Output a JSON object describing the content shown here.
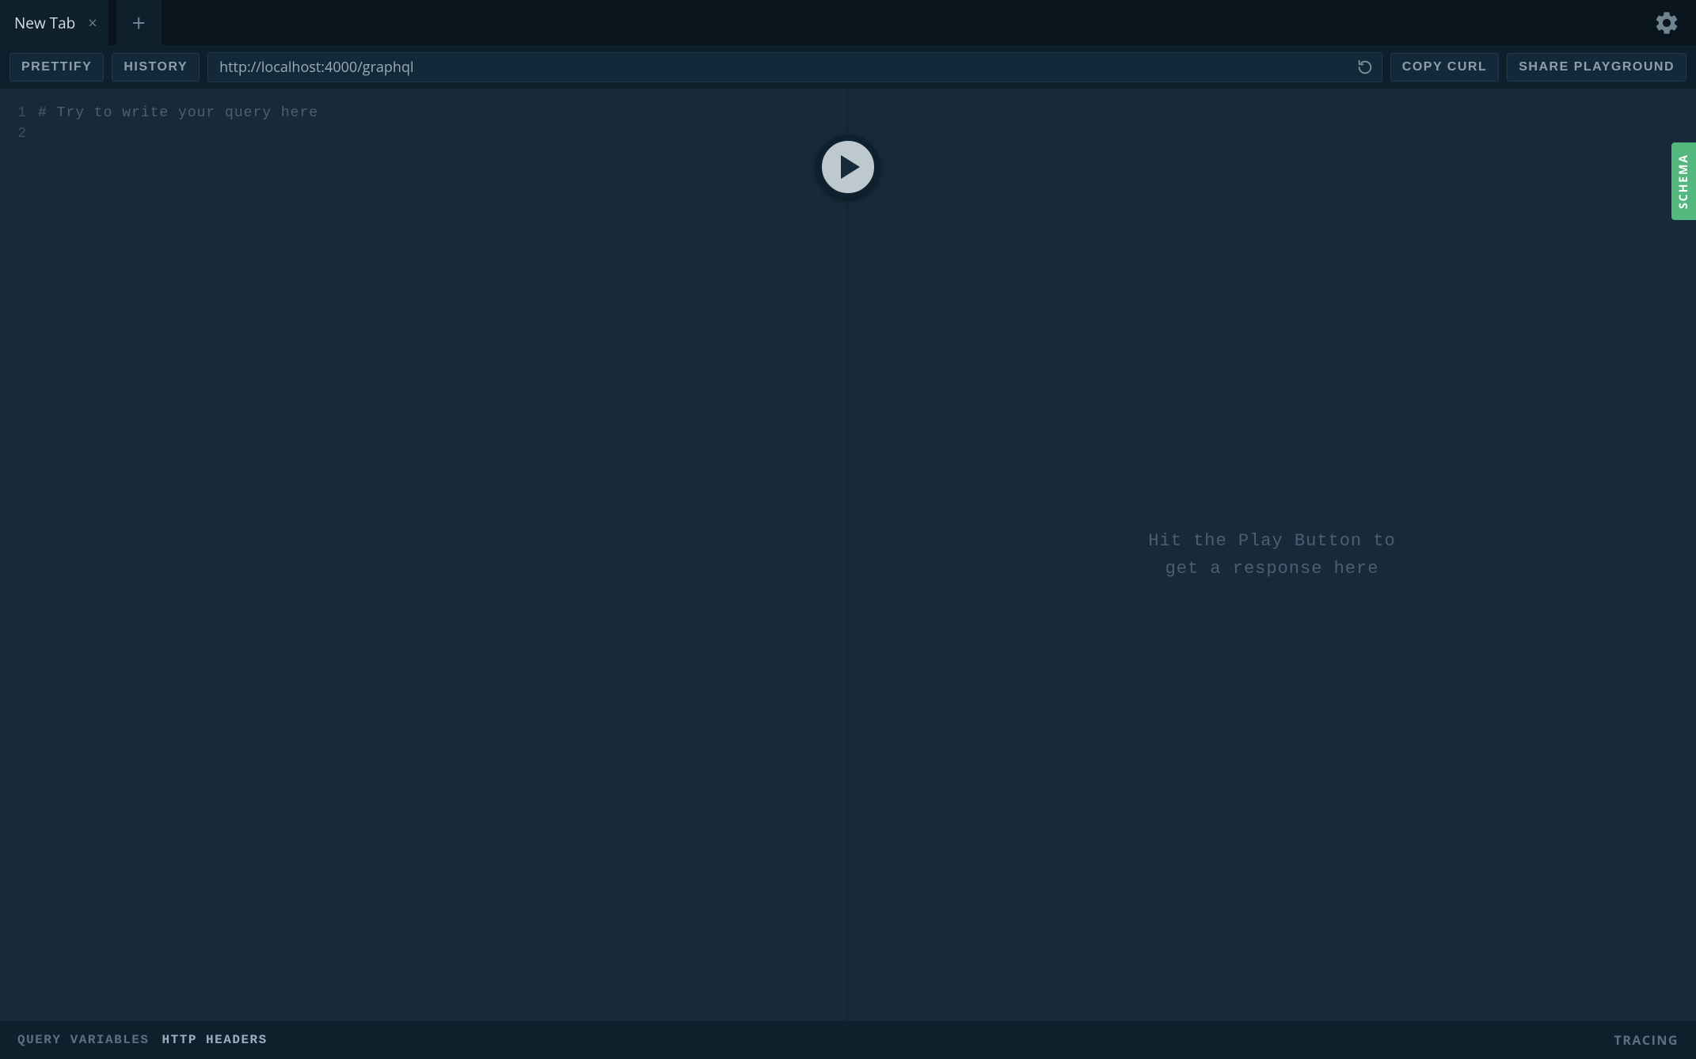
{
  "tabs": {
    "active_label": "New Tab"
  },
  "toolbar": {
    "prettify_label": "PRETTIFY",
    "history_label": "HISTORY",
    "endpoint_value": "http://localhost:4000/graphql",
    "copy_curl_label": "COPY CURL",
    "share_label": "SHARE PLAYGROUND"
  },
  "editor": {
    "line_numbers": {
      "l1": "1",
      "l2": "2"
    },
    "lines": {
      "l1": "# Try to write your query here",
      "l2": ""
    }
  },
  "bottom_tabs": {
    "query_variables": "QUERY VARIABLES",
    "http_headers": "HTTP HEADERS",
    "tracing": "TRACING"
  },
  "response": {
    "placeholder": "Hit the Play Button to\nget a response here"
  },
  "side": {
    "schema_label": "SCHEMA"
  }
}
